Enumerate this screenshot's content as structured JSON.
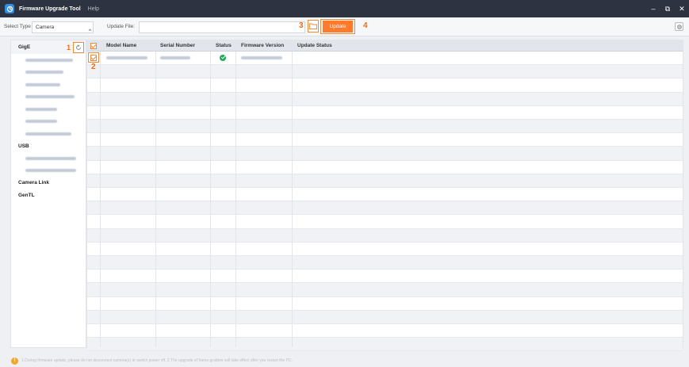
{
  "app": {
    "title": "Firmware Upgrade Tool",
    "menu_help": "Help",
    "window_controls": {
      "minimize": "–",
      "restore": "⧉",
      "close": "✕"
    }
  },
  "toolbar": {
    "select_type_label": "Select Type",
    "select_type_value": "Camera",
    "update_file_label": "Update File:",
    "update_file_value": "",
    "update_button": "Update",
    "folder_icon": "folder-open-icon",
    "settings_icon": "settings-icon"
  },
  "callouts": {
    "c1": "1",
    "c2": "2",
    "c3": "3",
    "c4": "4"
  },
  "sidebar": {
    "groups": [
      {
        "label": "GigE",
        "devices": [
          {
            "blurred": true
          },
          {
            "blurred": true
          },
          {
            "blurred": true
          },
          {
            "blurred": true
          },
          {
            "blurred": true
          },
          {
            "blurred": true
          },
          {
            "blurred": true
          }
        ]
      },
      {
        "label": "USB",
        "devices": [
          {
            "blurred": true
          },
          {
            "blurred": true
          }
        ]
      },
      {
        "label": "Camera Link",
        "devices": []
      },
      {
        "label": "GenTL",
        "devices": []
      }
    ],
    "refresh_icon": "refresh-icon"
  },
  "table": {
    "columns": [
      "Model Name",
      "Serial Number",
      "Status",
      "Firmware Version",
      "Update Status"
    ],
    "select_all_checked": true,
    "rows": [
      {
        "checked": true,
        "model_name_blurred": true,
        "serial_blurred": true,
        "status": "ok",
        "firmware_blurred": true,
        "update_status": ""
      }
    ],
    "empty_rows": 21,
    "status_ok_icon": "check-circle-icon"
  },
  "footer": {
    "warning_icon": "warning-icon",
    "note": "1.During firmware update, please do not disconnect camera(s) or switch power off. 2.The upgrade of frame grabber will take effect after you restart the PC."
  },
  "colors": {
    "accent": "#ff7a2b",
    "titlebar": "#2d3340",
    "status_ok": "#21a85a"
  }
}
